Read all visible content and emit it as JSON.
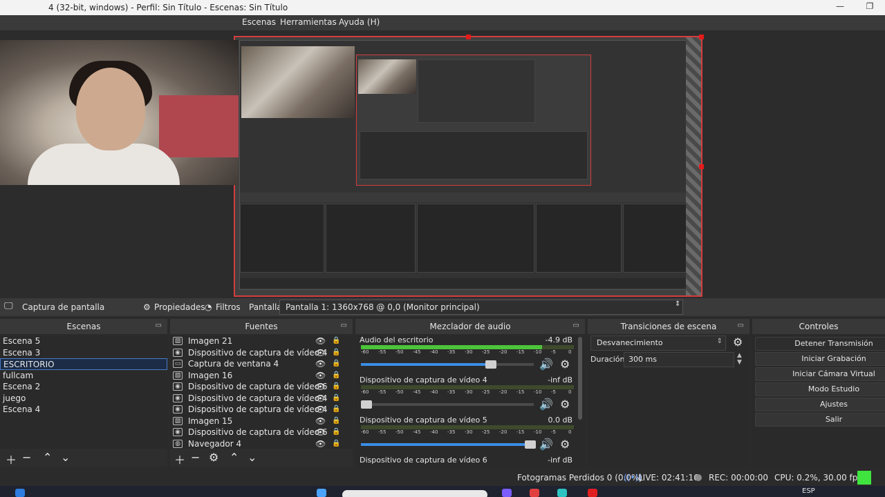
{
  "window": {
    "title": "4 (32-bit, windows) - Perfil: Sin Título - Escenas: Sin Título",
    "minimize": "—",
    "maximize": "❐"
  },
  "menu": {
    "escenas": "Escenas",
    "herramientas": "Herramientas",
    "ayuda": "Ayuda (H)"
  },
  "source_toolbar": {
    "selected_source": "Captura de pantalla",
    "properties": "Propiedades",
    "filters": "Filtros",
    "display_label": "Pantalla",
    "display_value": "Pantalla 1: 1360x768 @ 0,0 (Monitor principal)"
  },
  "scenes": {
    "title": "Escenas",
    "items": [
      "Escena 5",
      "Escena 3",
      "ESCRITORIO",
      "fullcam",
      "Escena 2",
      "juego",
      "Escena 4"
    ],
    "selected": "ESCRITORIO"
  },
  "sources": {
    "title": "Fuentes",
    "items": [
      {
        "label": "Imagen 21",
        "icon": "image-icon"
      },
      {
        "label": "Dispositivo de captura de vídeo 4",
        "icon": "camera-icon"
      },
      {
        "label": "Captura de ventana 4",
        "icon": "window-icon"
      },
      {
        "label": "Imagen 16",
        "icon": "image-icon"
      },
      {
        "label": "Dispositivo de captura de vídeo 6",
        "icon": "camera-icon"
      },
      {
        "label": "Dispositivo de captura de vídeo 4",
        "icon": "camera-icon"
      },
      {
        "label": "Dispositivo de captura de vídeo 4",
        "icon": "camera-icon"
      },
      {
        "label": "Imagen 15",
        "icon": "image-icon"
      },
      {
        "label": "Dispositivo de captura de vídeo 6",
        "icon": "camera-icon"
      },
      {
        "label": "Navegador 4",
        "icon": "globe-icon"
      }
    ]
  },
  "mixer": {
    "title": "Mezclador de audio",
    "ticks": [
      "-60",
      "-55",
      "-50",
      "-45",
      "-40",
      "-35",
      "-30",
      "-25",
      "-20",
      "-15",
      "-10",
      "-5",
      "0"
    ],
    "channels": [
      {
        "name": "Audio del escritorio",
        "db": "-4.9 dB",
        "level": 0.85,
        "volume": 0.75
      },
      {
        "name": "Dispositivo de captura de vídeo 4",
        "db": "-inf dB",
        "level": 0.0,
        "volume": 0.02
      },
      {
        "name": "Dispositivo de captura de vídeo 5",
        "db": "0.0 dB",
        "level": 0.0,
        "volume": 0.98
      },
      {
        "name": "Dispositivo de captura de vídeo 6",
        "db": "-inf dB",
        "level": 0.0,
        "volume": 0.0
      }
    ]
  },
  "transitions": {
    "title": "Transiciones de escena",
    "selected": "Desvanecimiento",
    "duration_label": "Duración",
    "duration_value": "300 ms"
  },
  "controls": {
    "title": "Controles",
    "buttons": [
      "Detener Transmisión",
      "Iniciar Grabación",
      "Iniciar Cámara Virtual",
      "Modo Estudio",
      "Ajustes",
      "Salir"
    ]
  },
  "status": {
    "dropped": "Fotogramas Perdidos 0 (0.0%)",
    "live": "LIVE: 02:41:16",
    "rec": "REC: 00:00:00",
    "cpu": "CPU: 0.2%, 30.00 fps"
  },
  "taskbar": {
    "lang": "ESP"
  },
  "colors": {
    "accent_red": "#d43d3d",
    "meter_green": "#4cc43a",
    "selected_row": "#1c2c46",
    "slider_blue": "#3a8ee6",
    "status_green": "#3fe43f"
  }
}
